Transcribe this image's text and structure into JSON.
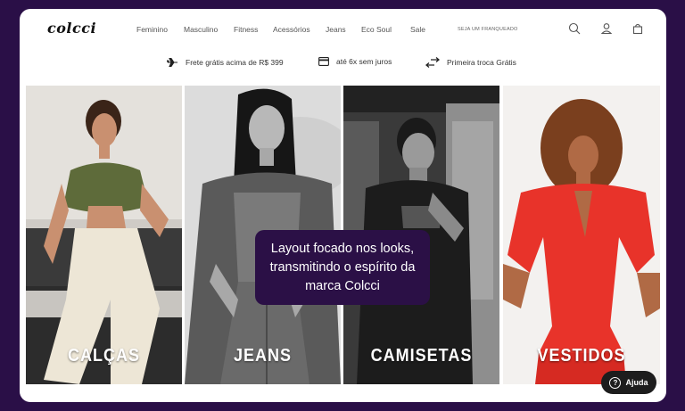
{
  "brand": {
    "logo_text": "colcci"
  },
  "nav": {
    "items": [
      {
        "label": "Feminino"
      },
      {
        "label": "Masculino"
      },
      {
        "label": "Fitness"
      },
      {
        "label": "Acessórios"
      },
      {
        "label": "Jeans"
      },
      {
        "label": "Eco Soul"
      },
      {
        "label": "Sale"
      }
    ],
    "franchise_link": "SEJA UM FRANQUEADO",
    "icons": [
      "search-icon",
      "user-icon",
      "bag-icon"
    ]
  },
  "promo": [
    {
      "icon": "airplane-icon",
      "text": "Frete grátis acima de R$ 399"
    },
    {
      "icon": "card-icon",
      "text": "até 6x sem juros"
    },
    {
      "icon": "exchange-icon",
      "text": "Primeira troca Grátis"
    }
  ],
  "categories": [
    {
      "label": "CALÇAS"
    },
    {
      "label": "JEANS"
    },
    {
      "label": "CAMISETAS"
    },
    {
      "label": "VESTIDOS"
    }
  ],
  "overlay_text": "Layout focado nos looks, transmitindo o espírito da marca Colcci",
  "help": {
    "label": "Ajuda"
  },
  "colors": {
    "page_bg": "#2a0f47",
    "overlay_bg": "#2b1046",
    "dress_red": "#e8332a"
  }
}
